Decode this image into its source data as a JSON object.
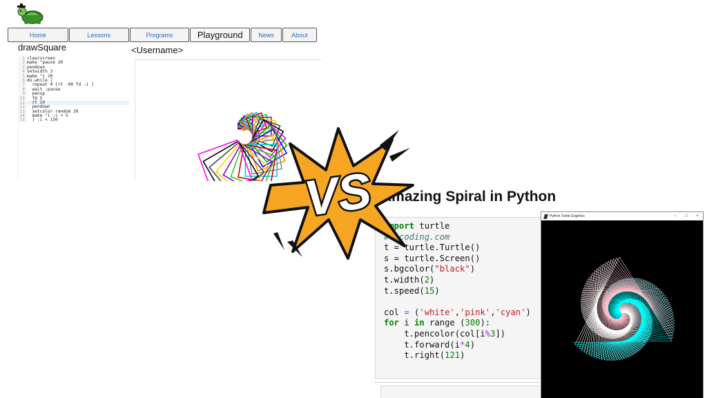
{
  "nav": {
    "tabs": [
      {
        "label": "Home",
        "width": 88
      },
      {
        "label": "Lessons",
        "width": 87
      },
      {
        "label": "Programs",
        "width": 87
      },
      {
        "label": "Playground",
        "width": 87,
        "active": true
      },
      {
        "label": "News",
        "width": 45
      },
      {
        "label": "About",
        "width": 50
      }
    ]
  },
  "playground": {
    "procedure_name": "drawSquare",
    "username": "<Username>",
    "code_lines": [
      "clearscreen",
      "make \"pause 20",
      "pendown",
      "setwidth 3",
      "make \"i 20",
      "do.while [",
      "  repeat 4 [rt -90 fd :i ]",
      "  wait :pause",
      "  penup",
      "  fd 5",
      "  rt 10",
      "  pendown",
      "  setcolor random 20",
      "  make \"i :i + 5",
      "  ] :i < 150"
    ],
    "highlight_line": 11,
    "square_colors": [
      "#000000",
      "#ff00ff",
      "#00aa00",
      "#0000ff",
      "#ff8800",
      "#888888",
      "#00cccc",
      "#cc0000",
      "#22cc22",
      "#8800cc",
      "#ffcc00",
      "#444444"
    ]
  },
  "vs_label": "VS",
  "python": {
    "title": "Amazing Spiral in Python",
    "code": [
      [
        [
          "kw",
          "import"
        ],
        [
          "t",
          " turtle"
        ]
      ],
      [
        [
          "cm",
          "#clcoding.com"
        ]
      ],
      [
        [
          "t",
          "t = turtle.Turtle()"
        ]
      ],
      [
        [
          "t",
          "s = turtle.Screen()"
        ]
      ],
      [
        [
          "t",
          "s.bgcolor("
        ],
        [
          "st",
          "\"black\""
        ],
        [
          "t",
          ")"
        ]
      ],
      [
        [
          "t",
          "t.width("
        ],
        [
          "nm",
          "2"
        ],
        [
          "t",
          ")"
        ]
      ],
      [
        [
          "t",
          "t.speed("
        ],
        [
          "nm",
          "15"
        ],
        [
          "t",
          ")"
        ]
      ],
      [
        [
          "t",
          ""
        ]
      ],
      [
        [
          "t",
          "col "
        ],
        [
          "op",
          "="
        ],
        [
          "t",
          " ("
        ],
        [
          "st",
          "'white'"
        ],
        [
          "t",
          ","
        ],
        [
          "st",
          "'pink'"
        ],
        [
          "t",
          ","
        ],
        [
          "st",
          "'cyan'"
        ],
        [
          "t",
          ")"
        ]
      ],
      [
        [
          "kw",
          "for"
        ],
        [
          "t",
          " i "
        ],
        [
          "kw",
          "in"
        ],
        [
          "t",
          " range ("
        ],
        [
          "nm",
          "300"
        ],
        [
          "t",
          "):"
        ]
      ],
      [
        [
          "t",
          "    t.pencolor(col[i"
        ],
        [
          "op",
          "%"
        ],
        [
          "nm",
          "3"
        ],
        [
          "t",
          "])"
        ]
      ],
      [
        [
          "t",
          "    t.forward(i"
        ],
        [
          "op",
          "*"
        ],
        [
          "nm",
          "4"
        ],
        [
          "t",
          ")"
        ]
      ],
      [
        [
          "t",
          "    t.right("
        ],
        [
          "nm",
          "121"
        ],
        [
          "t",
          ")"
        ]
      ]
    ],
    "window": {
      "title": "Python Turtle Graphics",
      "minimize": "–",
      "maximize": "□",
      "close": "×",
      "pen_colors": [
        "#ffffff",
        "#ffc0cb",
        "#00ffff"
      ],
      "iterations": 300,
      "step": 4,
      "angle": 121
    }
  },
  "colors": {
    "burst_fill": "#f7a623",
    "burst_stroke": "#111111"
  }
}
